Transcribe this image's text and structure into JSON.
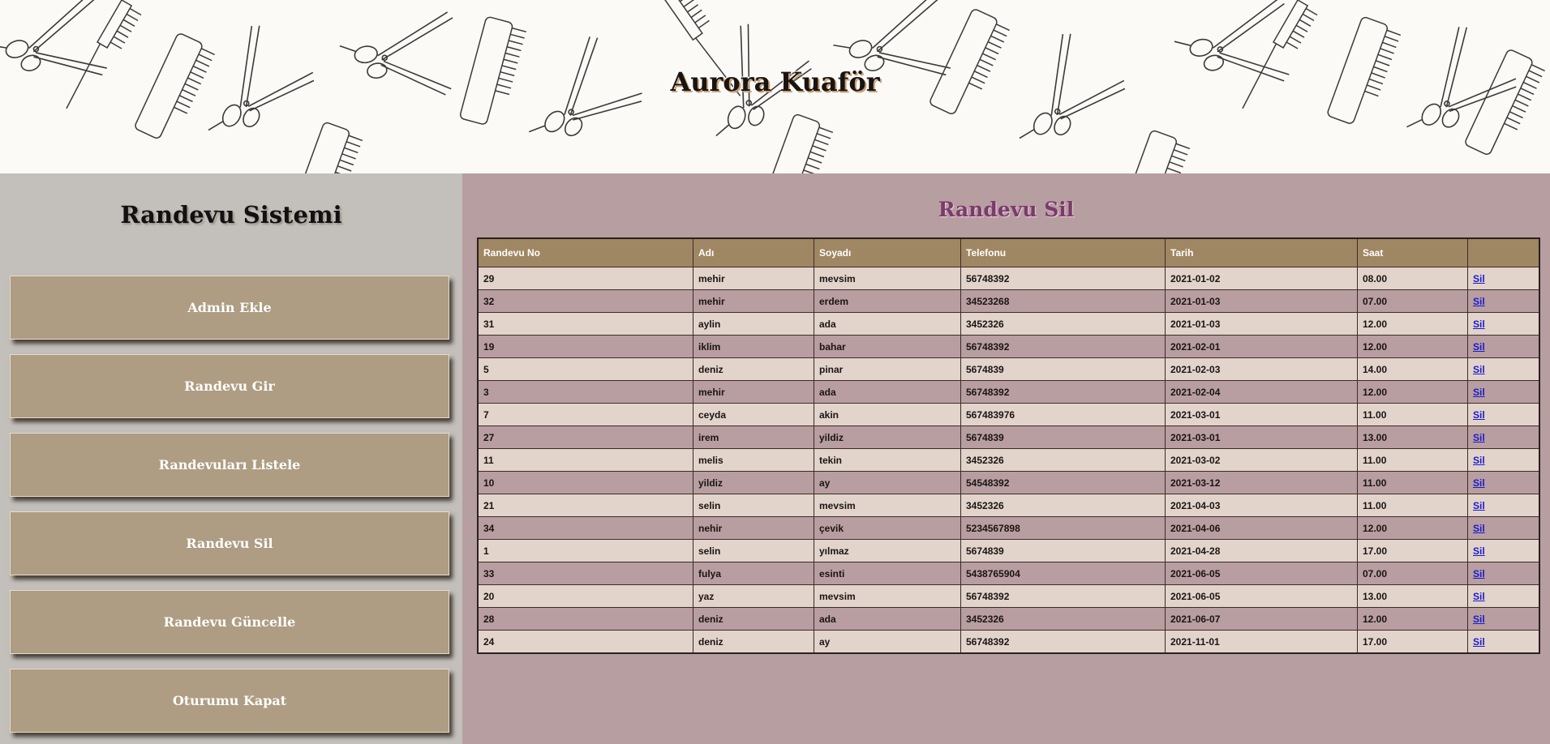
{
  "header": {
    "title": "Aurora Kuaför"
  },
  "sidebar": {
    "title": "Randevu Sistemi",
    "items": [
      {
        "label": "Admin Ekle"
      },
      {
        "label": "Randevu Gir"
      },
      {
        "label": "Randevuları Listele"
      },
      {
        "label": "Randevu Sil"
      },
      {
        "label": "Randevu Güncelle"
      },
      {
        "label": "Oturumu Kapat"
      }
    ]
  },
  "main": {
    "title": "Randevu Sil",
    "columns": [
      "Randevu No",
      "Adı",
      "Soyadı",
      "Telefonu",
      "Tarih",
      "Saat",
      ""
    ],
    "delete_label": "Sil",
    "rows": [
      [
        "29",
        "mehir",
        "mevsim",
        "56748392",
        "2021-01-02",
        "08.00"
      ],
      [
        "32",
        "mehir",
        "erdem",
        "34523268",
        "2021-01-03",
        "07.00"
      ],
      [
        "31",
        "aylin",
        "ada",
        "3452326",
        "2021-01-03",
        "12.00"
      ],
      [
        "19",
        "iklim",
        "bahar",
        "56748392",
        "2021-02-01",
        "12.00"
      ],
      [
        "5",
        "deniz",
        "pinar",
        "5674839",
        "2021-02-03",
        "14.00"
      ],
      [
        "3",
        "mehir",
        "ada",
        "56748392",
        "2021-02-04",
        "12.00"
      ],
      [
        "7",
        "ceyda",
        "akin",
        "567483976",
        "2021-03-01",
        "11.00"
      ],
      [
        "27",
        "irem",
        "yildiz",
        "5674839",
        "2021-03-01",
        "13.00"
      ],
      [
        "11",
        "melis",
        "tekin",
        "3452326",
        "2021-03-02",
        "11.00"
      ],
      [
        "10",
        "yildiz",
        "ay",
        "54548392",
        "2021-03-12",
        "11.00"
      ],
      [
        "21",
        "selin",
        "mevsim",
        "3452326",
        "2021-04-03",
        "11.00"
      ],
      [
        "34",
        "nehir",
        "çevik",
        "5234567898",
        "2021-04-06",
        "12.00"
      ],
      [
        "1",
        "selin",
        "yılmaz",
        "5674839",
        "2021-04-28",
        "17.00"
      ],
      [
        "33",
        "fulya",
        "esinti",
        "5438765904",
        "2021-06-05",
        "07.00"
      ],
      [
        "20",
        "yaz",
        "mevsim",
        "56748392",
        "2021-06-05",
        "13.00"
      ],
      [
        "28",
        "deniz",
        "ada",
        "3452326",
        "2021-06-07",
        "12.00"
      ],
      [
        "24",
        "deniz",
        "ay",
        "56748392",
        "2021-11-01",
        "17.00"
      ]
    ]
  },
  "colors": {
    "banner_bg": "#fbfaf7",
    "sidebar_bg": "#c3bfbb",
    "button_bg": "#ae9d82",
    "main_bg": "#b79ea0",
    "table_header_bg": "#a08763",
    "row_light": "#e2d4cb",
    "row_dark": "#b89ea0",
    "title_accent": "#7a3b6b"
  }
}
